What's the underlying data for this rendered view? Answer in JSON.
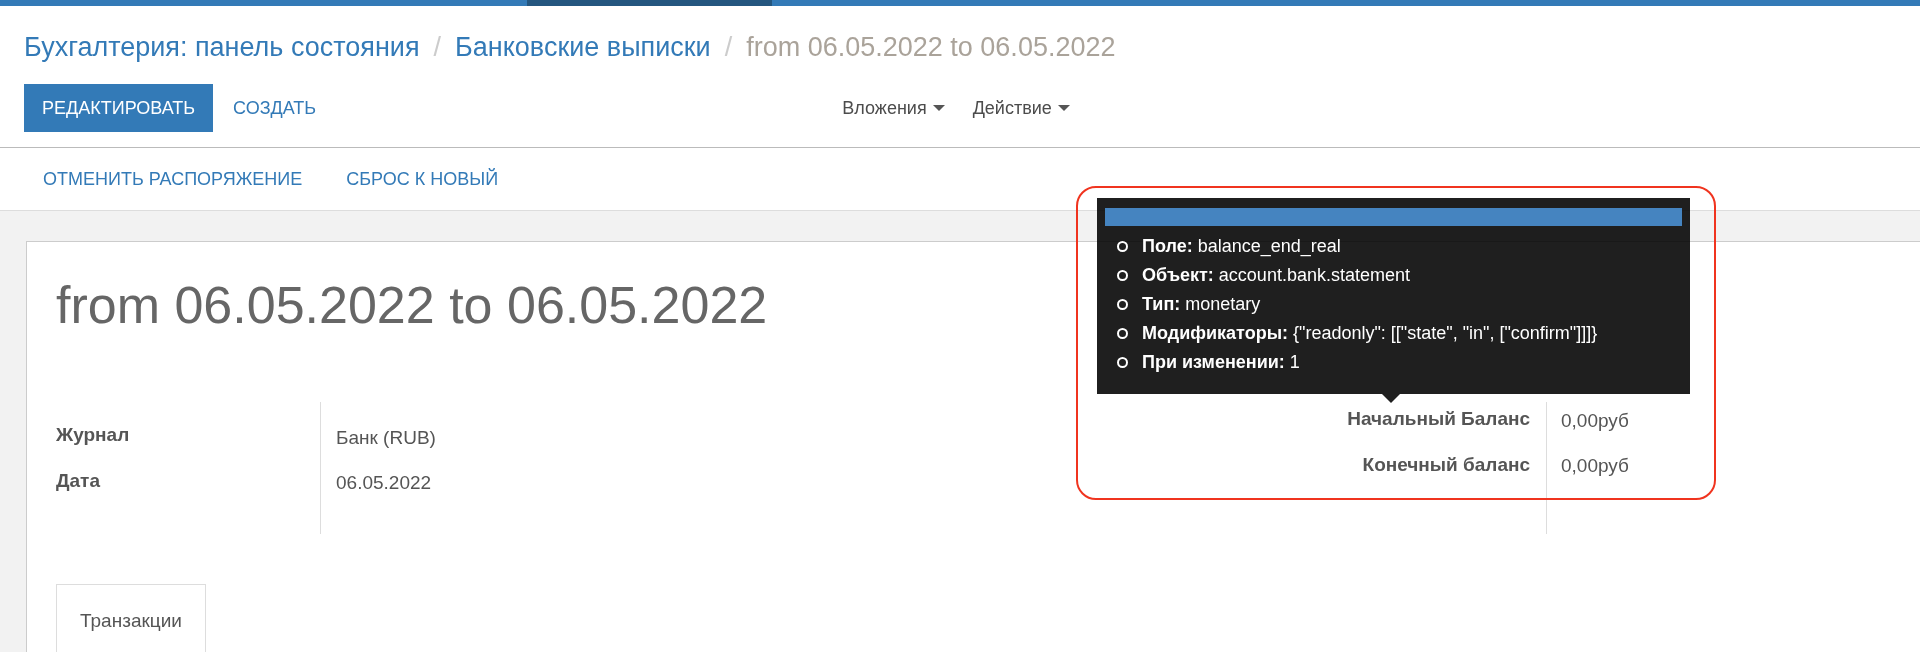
{
  "breadcrumb": [
    {
      "label": "Бухгалтерия: панель состояния",
      "kind": "link",
      "separator": "/"
    },
    {
      "label": "Банковские выписки",
      "kind": "link",
      "separator": "/"
    },
    {
      "label": "from 06.05.2022 to 06.05.2022",
      "kind": "current"
    }
  ],
  "buttons": [
    {
      "label": "РЕДАКТИРОВАТЬ",
      "kind": "primary"
    },
    {
      "label": "СОЗДАТЬ",
      "kind": "link"
    }
  ],
  "dropdowns": [
    "Вложения",
    "Действие"
  ],
  "actions": [
    "ОТМЕНИТЬ РАСПОРЯЖЕНИЕ",
    "СБРОС К НОВЫЙ"
  ],
  "sheet": {
    "title": "from 06.05.2022 to 06.05.2022",
    "fields": [
      {
        "label": "Журнал",
        "value": "Банк (RUB)"
      },
      {
        "label": "Дата",
        "value": "06.05.2022"
      }
    ],
    "balances": [
      {
        "label": "Начальный Баланс",
        "value": "0,00руб"
      },
      {
        "label": "Конечный баланс",
        "value": "0,00руб"
      }
    ],
    "tabs": [
      {
        "label": "Транзакции",
        "selected": true
      }
    ]
  },
  "tooltip": {
    "items": [
      "**Поле:** balance_end_real",
      "**Объект:** account.bank.statement",
      "**Тип:** monetary",
      "**Модификаторы:** {\"readonly\": [[\"state\", \"in\", [\"confirm\"]]]}",
      "**При изменении:** 1"
    ]
  }
}
